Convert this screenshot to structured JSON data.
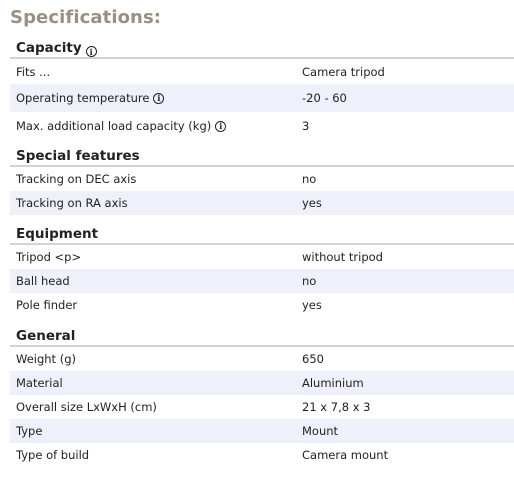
{
  "page_title": "Specifications:",
  "sections": [
    {
      "title": "Capacity",
      "has_info": true,
      "rows": [
        {
          "label": "Fits ...",
          "value": "Camera tripod",
          "has_info": false
        },
        {
          "label": "Operating temperature",
          "value": "-20 - 60",
          "has_info": true
        },
        {
          "label": "Max. additional load capacity (kg)",
          "value": "3",
          "has_info": true
        }
      ]
    },
    {
      "title": "Special features",
      "has_info": false,
      "rows": [
        {
          "label": "Tracking on DEC axis",
          "value": "no",
          "has_info": false
        },
        {
          "label": "Tracking on RA axis",
          "value": "yes",
          "has_info": false
        }
      ]
    },
    {
      "title": "Equipment",
      "has_info": false,
      "rows": [
        {
          "label": "Tripod <p>",
          "value": "without tripod",
          "has_info": false
        },
        {
          "label": "Ball head",
          "value": "no",
          "has_info": false
        },
        {
          "label": "Pole finder",
          "value": "yes",
          "has_info": false
        }
      ]
    },
    {
      "title": "General",
      "has_info": false,
      "rows": [
        {
          "label": "Weight (g)",
          "value": "650",
          "has_info": false
        },
        {
          "label": "Material",
          "value": "Aluminium",
          "has_info": false
        },
        {
          "label": "Overall size LxWxH (cm)",
          "value": "21 x 7,8 x 3",
          "has_info": false
        },
        {
          "label": "Type",
          "value": "Mount",
          "has_info": false
        },
        {
          "label": "Type of build",
          "value": "Camera mount",
          "has_info": false
        }
      ]
    }
  ],
  "colors": {
    "title": "#9a8f82",
    "row_alt_bg": "#eef1fa",
    "divider": "#d3d3d3"
  },
  "icons": {
    "info": "info-icon"
  }
}
